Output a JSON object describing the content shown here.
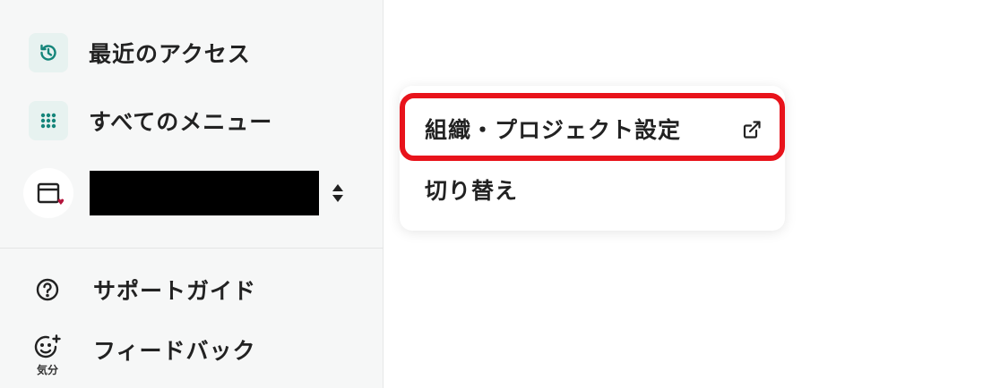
{
  "sidebar": {
    "recent": {
      "label": "最近のアクセス",
      "icon": "history-icon"
    },
    "all_menu": {
      "label": "すべてのメニュー",
      "icon": "grid-icon"
    },
    "org": {
      "avatar_icon": "window-icon",
      "name": "",
      "switch_icon": "sort-arrows-icon"
    },
    "support": {
      "label": "サポートガイド",
      "icon": "help-circle-icon"
    },
    "feedback": {
      "label": "フィードバック",
      "icon": "smiley-plus-icon",
      "caption": "気分"
    }
  },
  "dropdown": {
    "items": [
      {
        "label": "組織・プロジェクト設定",
        "icon": "external-link-icon",
        "highlighted": true
      },
      {
        "label": "切り替え"
      }
    ]
  },
  "colors": {
    "accent": "#14857a",
    "highlight": "#e8131b",
    "sidebar_bg": "#f6f7f7"
  }
}
